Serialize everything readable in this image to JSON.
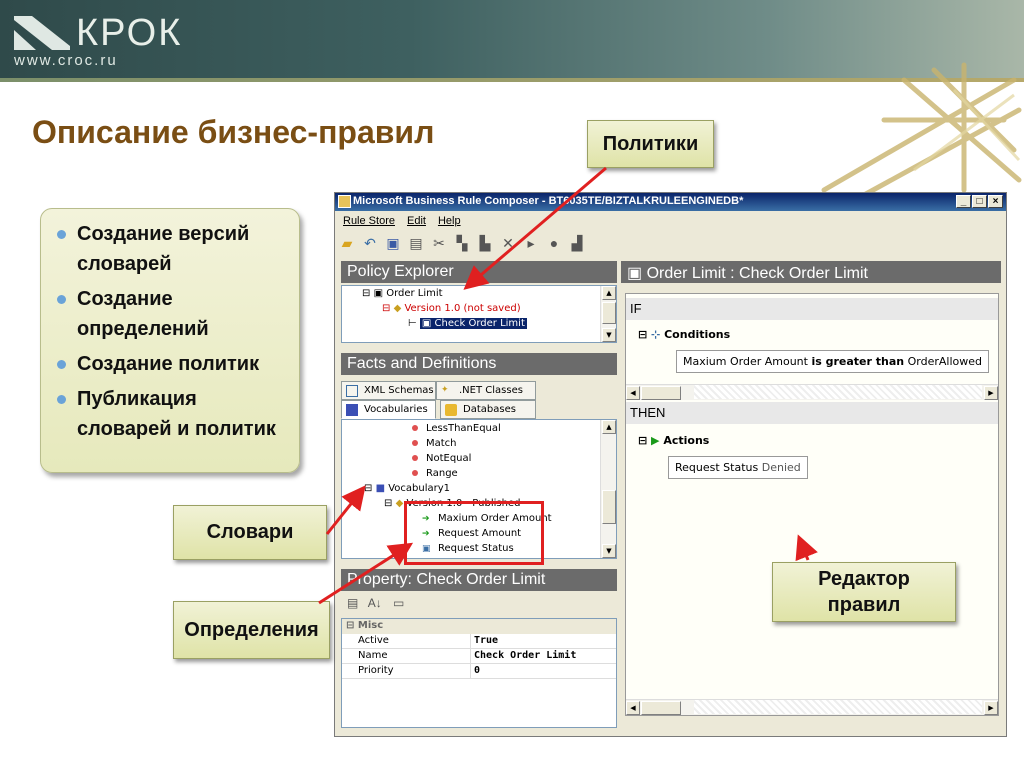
{
  "header": {
    "logo_name": "КРОК",
    "logo_url": "www.croc.ru"
  },
  "slide": {
    "title": "Описание бизнес-правил",
    "bullets": [
      "Создание версий словарей",
      "Создание определений",
      "Создание политик",
      "Публикация словарей и политик"
    ],
    "callouts": {
      "policies": "Политики",
      "vocabularies": "Словари",
      "definitions": "Определения",
      "rule_editor_line1": "Редактор",
      "rule_editor_line2": "правил"
    }
  },
  "window": {
    "title": "Microsoft Business Rule Composer - BT6035TE/BIZTALKRULEENGINEDB*",
    "controls": [
      "_",
      "□",
      "×"
    ],
    "menu": [
      "Rule Store",
      "Edit",
      "Help"
    ]
  },
  "policy_explorer": {
    "title": "Policy Explorer",
    "tree": {
      "policy": "Order Limit",
      "version": "Version 1.0 (not saved)",
      "rule": "Check Order Limit"
    }
  },
  "facts": {
    "title": "Facts and Definitions",
    "tabs": [
      "XML Schemas",
      ".NET Classes",
      "Vocabularies",
      "Databases"
    ],
    "active_tab": "Vocabularies",
    "items": [
      "LessThanEqual",
      "Match",
      "NotEqual",
      "Range"
    ],
    "vocabulary": "Vocabulary1",
    "vocab_version": "Version 1.0 - Published",
    "definitions": [
      "Maxium Order Amount",
      "Request Amount",
      "Request Status"
    ]
  },
  "property": {
    "title": "Property: Check Order Limit",
    "category": "Misc",
    "rows": [
      {
        "name": "Active",
        "value": "True"
      },
      {
        "name": "Name",
        "value": "Check Order Limit"
      },
      {
        "name": "Priority",
        "value": "0"
      }
    ]
  },
  "editor": {
    "title": "Order Limit : Check Order Limit",
    "if_label": "IF",
    "conditions_label": "Conditions",
    "condition": {
      "left": "Maxium Order Amount",
      "op": "is greater than",
      "right": "OrderAllowed"
    },
    "then_label": "THEN",
    "actions_label": "Actions",
    "action": {
      "left": "Request Status",
      "value": "Denied"
    }
  },
  "colors": {
    "title": "#7a4e14",
    "callout_bg": "#e6e9bc",
    "highlight_red": "#e02020",
    "pane_header": "#6b6b6b"
  }
}
